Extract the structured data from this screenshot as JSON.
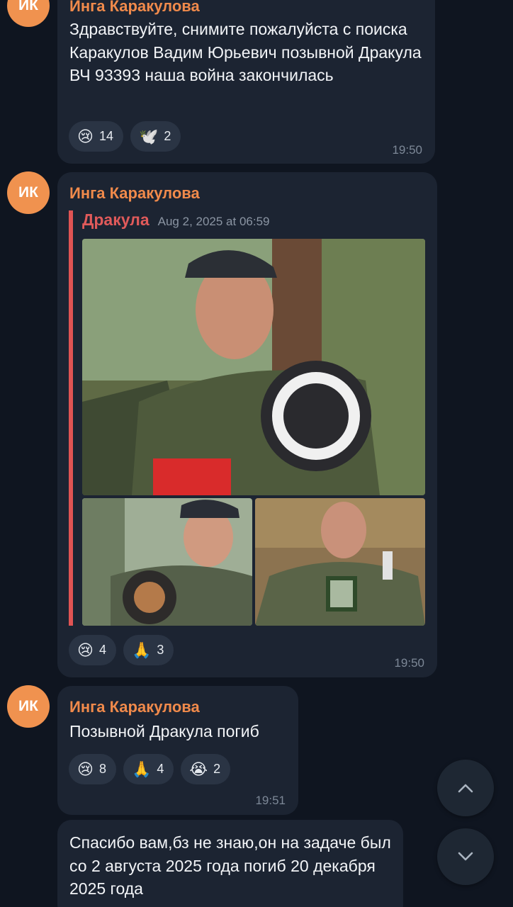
{
  "messages": [
    {
      "avatar_initials": "ИК",
      "sender": "Инга Каракулова",
      "text": "Здравствуйте, снимите пожалуйста с поиска Каракулов Вадим Юрьевич позывной Дракула ВЧ 93393 наша война закончилась",
      "reactions": [
        {
          "emoji": "😢",
          "count": "14"
        },
        {
          "emoji": "🕊️",
          "count": "2"
        }
      ],
      "time": "19:50"
    },
    {
      "avatar_initials": "ИК",
      "sender": "Инга Каракулова",
      "forwarded_from": "Дракула",
      "forwarded_date": "Aug 2, 2025 at 06:59",
      "reactions": [
        {
          "emoji": "😢",
          "count": "4"
        },
        {
          "emoji": "🙏",
          "count": "3"
        }
      ],
      "time": "19:50"
    },
    {
      "avatar_initials": "ИК",
      "sender": "Инга Каракулова",
      "text": "Позывной Дракула погиб",
      "reactions": [
        {
          "emoji": "😢",
          "count": "8"
        },
        {
          "emoji": "🙏",
          "count": "4"
        },
        {
          "emoji": "😭",
          "count": "2"
        }
      ],
      "time": "19:51"
    },
    {
      "text": "Спасибо вам,бз не знаю,он на задаче был со 2 августа 2025 года погиб 20 декабря 2025 года"
    }
  ],
  "icons": {
    "scroll_up": "chevron-up-icon",
    "scroll_down": "chevron-down-icon"
  },
  "colors": {
    "background": "#0f1520",
    "bubble": "#1c2432",
    "sender_name": "#f08a4b",
    "avatar": "#f0924f",
    "forward_accent": "#e05454"
  }
}
